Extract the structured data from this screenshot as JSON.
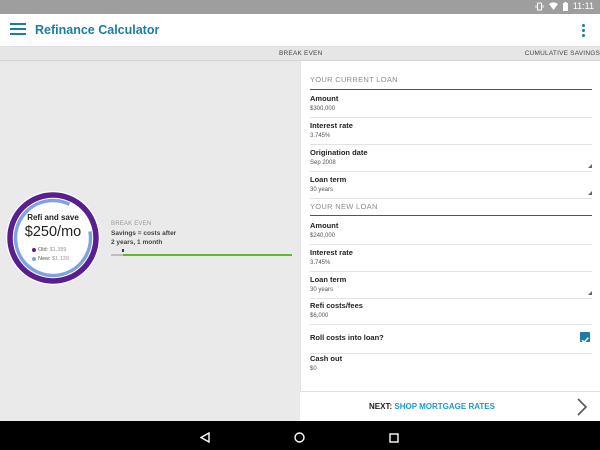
{
  "status_bar": {
    "time": "11:11"
  },
  "app_bar": {
    "title": "Refinance Calculator",
    "menu_icon": "hamburger-menu-icon",
    "overflow_icon": "more-vert-icon"
  },
  "tabs": [
    {
      "label": "BREAK EVEN"
    },
    {
      "label": "CUMULATIVE SAVINGS"
    }
  ],
  "summary": {
    "title": "Refi and save",
    "monthly_savings": "$250/mo",
    "old_label": "Old:",
    "old_value": "$1,389",
    "new_label": "New:",
    "new_value": "$1,139",
    "ring_colors": {
      "outer": "#5a1f8f",
      "inner": "#7fa3e0",
      "old_dot": "#5a1f8f",
      "new_dot": "#7fa3e0"
    }
  },
  "break_even": {
    "label": "BREAK EVEN",
    "line1": "Savings = costs after",
    "line2": "2 years, 1 month",
    "progress_color": "#5fba2e"
  },
  "current_loan": {
    "heading": "YOUR CURRENT LOAN",
    "amount": {
      "label": "Amount",
      "value": "$300,000"
    },
    "interest_rate": {
      "label": "Interest rate",
      "value": "3.745%"
    },
    "origination_date": {
      "label": "Origination date",
      "value": "Sep 2008"
    },
    "loan_term": {
      "label": "Loan term",
      "value": "30 years"
    }
  },
  "new_loan": {
    "heading": "YOUR NEW LOAN",
    "amount": {
      "label": "Amount",
      "value": "$240,000"
    },
    "interest_rate": {
      "label": "Interest rate",
      "value": "3.745%"
    },
    "loan_term": {
      "label": "Loan term",
      "value": "30 years"
    },
    "refi_costs": {
      "label": "Refi costs/fees",
      "value": "$6,000"
    },
    "roll_costs": {
      "label": "Roll costs into loan?",
      "checked": true
    },
    "cash_out": {
      "label": "Cash out",
      "value": "$0"
    }
  },
  "footer": {
    "next_prefix": "NEXT:",
    "next_link": "SHOP MORTGAGE RATES"
  },
  "accent_color": "#1c7ca8"
}
